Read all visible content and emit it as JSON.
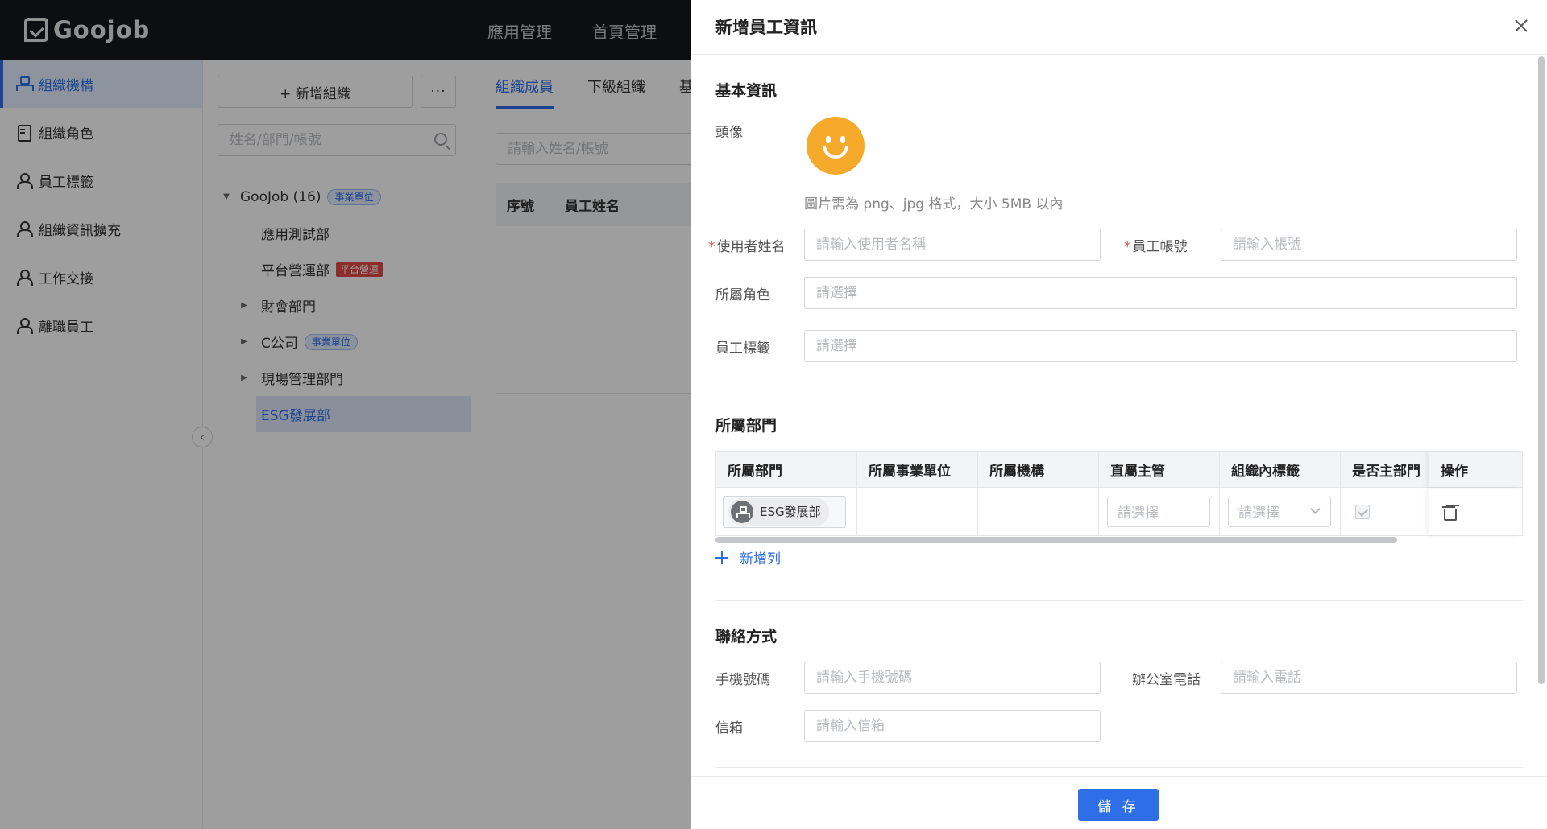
{
  "app": {
    "logo_text": "Goojob"
  },
  "topnav": {
    "items": [
      "應用管理",
      "首頁管理"
    ]
  },
  "sidebar": {
    "items": [
      {
        "label": "組織機構",
        "icon": "org-icon",
        "active": true
      },
      {
        "label": "組織角色",
        "icon": "document-icon"
      },
      {
        "label": "員工標籤",
        "icon": "user-tag-icon"
      },
      {
        "label": "組織資訊擴充",
        "icon": "user-icon"
      },
      {
        "label": "工作交接",
        "icon": "user-icon"
      },
      {
        "label": "離職員工",
        "icon": "user-icon"
      }
    ]
  },
  "tree_panel": {
    "add_button": "+ 新增組織",
    "more_button": "···",
    "search_placeholder": "姓名/部門/帳號",
    "nodes": [
      {
        "label": "GooJob (16)",
        "tag": "事業單位"
      },
      {
        "label": "應用測試部"
      },
      {
        "label": "平台營運部",
        "tag": "平台營運"
      },
      {
        "label": "財會部門"
      },
      {
        "label": "C公司",
        "tag": "事業單位"
      },
      {
        "label": "現場管理部門"
      },
      {
        "label": "ESG發展部",
        "selected": true
      }
    ]
  },
  "main": {
    "tabs": [
      "組織成員",
      "下級組織",
      "基"
    ],
    "search_placeholder": "請輸入姓名/帳號",
    "table_headers": [
      "序號",
      "員工姓名"
    ]
  },
  "drawer": {
    "title": "新增員工資訊",
    "basic": {
      "section_title": "基本資訊",
      "avatar_label": "頭像",
      "avatar_hint": "圖片需為 png、jpg 格式，大小 5MB 以內",
      "username_label": "使用者姓名",
      "username_placeholder": "請輸入使用者名稱",
      "account_label": "員工帳號",
      "account_placeholder": "請輸入帳號",
      "role_label": "所屬角色",
      "role_placeholder": "請選擇",
      "tag_label": "員工標籤",
      "tag_placeholder": "請選擇"
    },
    "dept": {
      "section_title": "所屬部門",
      "headers": [
        "所屬部門",
        "所屬事業單位",
        "所屬機構",
        "直屬主管",
        "組織內標籤",
        "是否主部門",
        "操作"
      ],
      "row": {
        "department": "ESG發展部",
        "manager_placeholder": "請選擇",
        "tag_placeholder": "請選擇"
      },
      "add_row": "新增列"
    },
    "contact": {
      "section_title": "聯絡方式",
      "mobile_label": "手機號碼",
      "mobile_placeholder": "請輸入手機號碼",
      "office_label": "辦公室電話",
      "office_placeholder": "請輸入電話",
      "email_label": "信箱",
      "email_placeholder": "請輸入信箱"
    },
    "save_button": "儲 存"
  },
  "colors": {
    "accent": "#2e6fe8",
    "topbar": "#14181e",
    "avatar": "#f6aa2c",
    "tag_red": "#e24a47"
  }
}
